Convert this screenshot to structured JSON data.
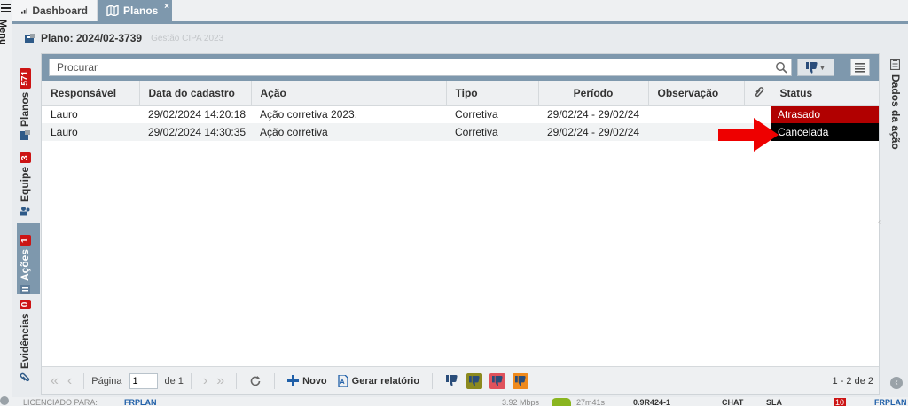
{
  "menu": {
    "label": "Menu"
  },
  "tabs": [
    {
      "label": "Dashboard",
      "icon": "bar-chart-icon"
    },
    {
      "label": "Planos",
      "icon": "map-icon",
      "close": "×"
    }
  ],
  "plan": {
    "title": "Plano: 2024/02-3739",
    "subtitle": "Gestão CIPA 2023"
  },
  "side_tabs": [
    {
      "label": "Planos",
      "badge": "571"
    },
    {
      "label": "Equipe",
      "badge": "3"
    },
    {
      "label": "Ações",
      "badge": "1"
    },
    {
      "label": "Evidências",
      "badge": "0"
    }
  ],
  "search": {
    "placeholder": "Procurar",
    "value": ""
  },
  "table": {
    "columns": [
      "Responsável",
      "Data do cadastro",
      "Ação",
      "Tipo",
      "Período",
      "Observação",
      "",
      "Status"
    ],
    "rows": [
      {
        "responsavel": "Lauro",
        "data": "29/02/2024 14:20:18",
        "acao": "Ação corretiva 2023.",
        "tipo": "Corretiva",
        "periodo": "29/02/24 - 29/02/24",
        "observacao": "",
        "status": "Atrasado",
        "status_color": "#b10000"
      },
      {
        "responsavel": "Lauro",
        "data": "29/02/2024 14:30:35",
        "acao": "Ação corretiva",
        "tipo": "Corretiva",
        "periodo": "29/02/24 - 29/02/24",
        "observacao": "",
        "status": "Cancelada",
        "status_color": "#000000"
      }
    ]
  },
  "footer": {
    "page_label": "Página",
    "page_value": "1",
    "page_of": "de 1",
    "new_label": "Novo",
    "report_label": "Gerar relatório",
    "count": "1 - 2 de 2",
    "filter_colors": [
      "#2a4d7a",
      "#8c8a1f",
      "#e0525c",
      "#f08a1c"
    ]
  },
  "right_panel": {
    "label": "Dados da ação"
  },
  "bottom_bar": {
    "licensed": "LICENCIADO PARA:",
    "brand": "FRPLAN",
    "speed": "3.92 Mbps",
    "time": "27m41s",
    "version": "0.9R424-1",
    "chat": "CHAT",
    "sla": "SLA",
    "notif": "10",
    "brand2": "FRPLAN"
  },
  "colors": {
    "accent": "#7e98ad",
    "badge": "#cc1414",
    "arrow": "#ee0000"
  }
}
